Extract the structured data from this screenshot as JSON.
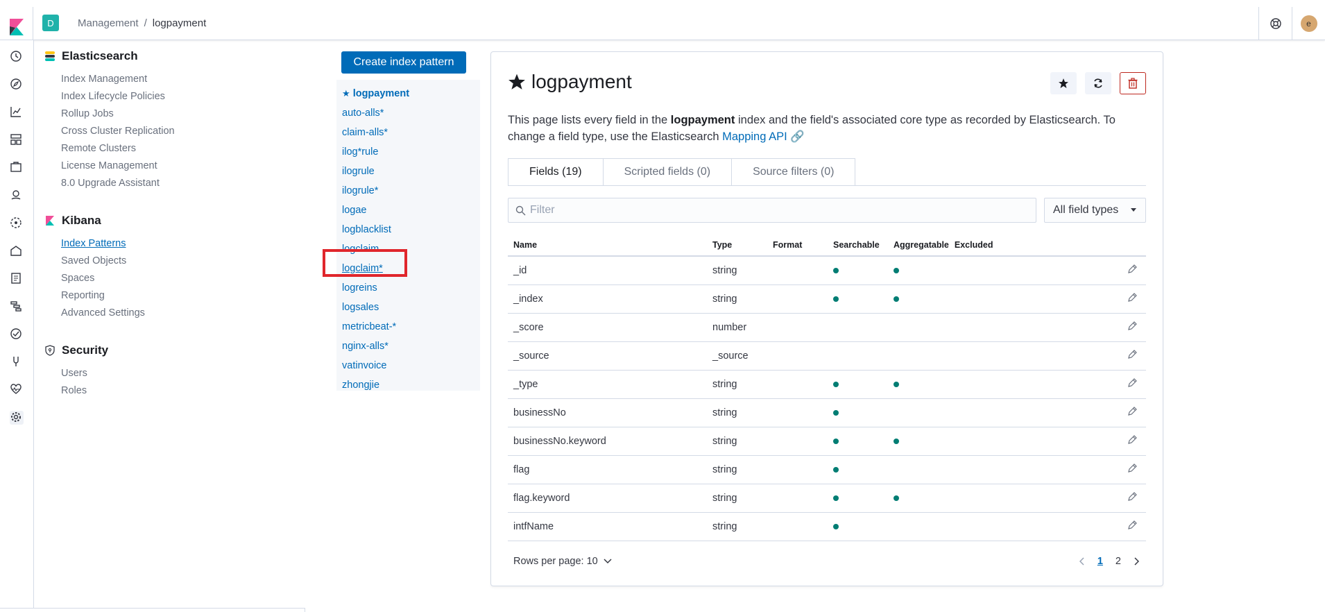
{
  "breadcrumb": {
    "parent": "Management",
    "separator": "/",
    "current": "logpayment"
  },
  "space": {
    "initial": "D"
  },
  "user": {
    "initial": "e"
  },
  "sidenav": {
    "elasticsearch": {
      "title": "Elasticsearch",
      "items": [
        "Index Management",
        "Index Lifecycle Policies",
        "Rollup Jobs",
        "Cross Cluster Replication",
        "Remote Clusters",
        "License Management",
        "8.0 Upgrade Assistant"
      ]
    },
    "kibana": {
      "title": "Kibana",
      "items": [
        "Index Patterns",
        "Saved Objects",
        "Spaces",
        "Reporting",
        "Advanced Settings"
      ]
    },
    "security": {
      "title": "Security",
      "items": [
        "Users",
        "Roles"
      ]
    }
  },
  "patterns": {
    "create_label": "Create index pattern",
    "items": [
      "logpayment",
      "auto-alls*",
      "claim-alls*",
      "ilog*rule",
      "ilogrule",
      "ilogrule*",
      "logae",
      "logblacklist",
      "logclaim",
      "logclaim*",
      "logreins",
      "logsales",
      "metricbeat-*",
      "nginx-alls*",
      "vatinvoice",
      "zhongjie"
    ]
  },
  "main": {
    "title": "logpayment",
    "desc_pre": "This page lists every field in the ",
    "desc_bold": "logpayment",
    "desc_mid": " index and the field's associated core type as recorded by Elasticsearch. To change a field type, use the Elasticsearch ",
    "desc_link": "Mapping API",
    "tabs": [
      "Fields (19)",
      "Scripted fields (0)",
      "Source filters (0)"
    ],
    "filter_placeholder": "Filter",
    "type_select": "All field types",
    "columns": [
      "Name",
      "Type",
      "Format",
      "Searchable",
      "Aggregatable",
      "Excluded"
    ],
    "rows": [
      {
        "name": "_id",
        "type": "string",
        "searchable": true,
        "aggregatable": true
      },
      {
        "name": "_index",
        "type": "string",
        "searchable": true,
        "aggregatable": true
      },
      {
        "name": "_score",
        "type": "number",
        "searchable": false,
        "aggregatable": false
      },
      {
        "name": "_source",
        "type": "_source",
        "searchable": false,
        "aggregatable": false
      },
      {
        "name": "_type",
        "type": "string",
        "searchable": true,
        "aggregatable": true
      },
      {
        "name": "businessNo",
        "type": "string",
        "searchable": true,
        "aggregatable": false
      },
      {
        "name": "businessNo.keyword",
        "type": "string",
        "searchable": true,
        "aggregatable": true
      },
      {
        "name": "flag",
        "type": "string",
        "searchable": true,
        "aggregatable": false
      },
      {
        "name": "flag.keyword",
        "type": "string",
        "searchable": true,
        "aggregatable": true
      },
      {
        "name": "intfName",
        "type": "string",
        "searchable": true,
        "aggregatable": false
      }
    ],
    "rows_per_page": "Rows per page: 10",
    "pages": [
      "1",
      "2"
    ]
  },
  "colors": {
    "accent": "#006bb8",
    "danger": "#bd271e",
    "dot": "#017d73",
    "highlight": "#e0262c"
  }
}
